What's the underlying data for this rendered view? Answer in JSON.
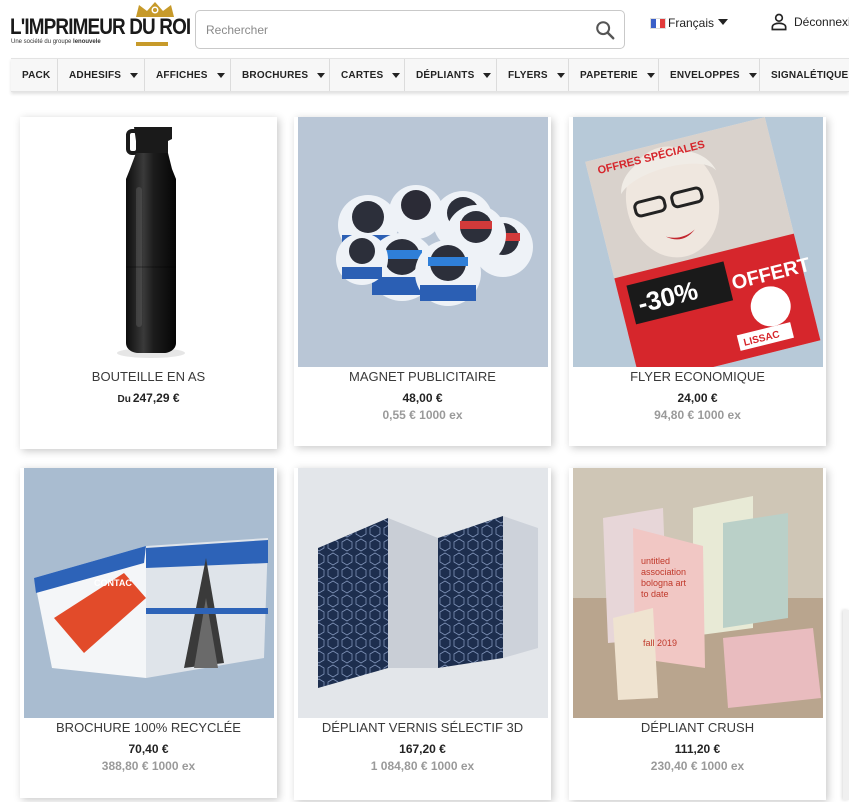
{
  "header": {
    "logo": {
      "title": "L'IMPRIMEUR DU ROI",
      "tagline_prefix": "Une société du groupe ",
      "tagline_brand": "lenouvele"
    },
    "search": {
      "placeholder": "Rechercher"
    },
    "language": {
      "label": "Français"
    },
    "account": {
      "label": "Déconnexi"
    }
  },
  "nav": {
    "items": [
      {
        "label": "PACK",
        "dropdown": false
      },
      {
        "label": "ADHESIFS",
        "dropdown": true
      },
      {
        "label": "AFFICHES",
        "dropdown": true
      },
      {
        "label": "BROCHURES",
        "dropdown": true
      },
      {
        "label": "CARTES",
        "dropdown": true
      },
      {
        "label": "DÉPLIANTS",
        "dropdown": true
      },
      {
        "label": "FLYERS",
        "dropdown": true
      },
      {
        "label": "PAPETERIE",
        "dropdown": true
      },
      {
        "label": "ENVELOPPES",
        "dropdown": true
      },
      {
        "label": "SIGNALÉTIQUE",
        "dropdown": false
      }
    ]
  },
  "products": [
    {
      "name": "BOUTEILLE EN AS",
      "price_prefix": "Du",
      "price": "247,29 €",
      "unit_price": ""
    },
    {
      "name": "MAGNET PUBLICITAIRE",
      "price_prefix": "",
      "price": "48,00 €",
      "unit_price": "0,55 € 1000 ex"
    },
    {
      "name": "FLYER ECONOMIQUE",
      "price_prefix": "",
      "price": "24,00 €",
      "unit_price": "94,80 € 1000 ex"
    },
    {
      "name": "BROCHURE 100% RECYCLÉE",
      "price_prefix": "",
      "price": "70,40 €",
      "unit_price": "388,80 € 1000 ex"
    },
    {
      "name": "DÉPLIANT VERNIS SÉLECTIF 3D",
      "price_prefix": "",
      "price": "167,20 €",
      "unit_price": "1 084,80 € 1000 ex"
    },
    {
      "name": "DÉPLIANT CRUSH",
      "price_prefix": "",
      "price": "111,20 €",
      "unit_price": "230,40 € 1000 ex"
    }
  ],
  "images": {
    "flyer": {
      "headline": "OFFRES SPÉCIALES",
      "discount": "-30%",
      "offer": "OFFERT",
      "brand": "LISSAC"
    },
    "brochure": {
      "brand": "CONTAC"
    },
    "crush": {
      "lines": [
        "untitled",
        "association",
        "bologna art",
        "to date"
      ],
      "year": "fall 2019"
    }
  },
  "colors": {
    "accent_gold": "#c79a2a",
    "nav_bg": "#f7f7f7",
    "text": "#232323",
    "muted": "#9a9a9a"
  }
}
